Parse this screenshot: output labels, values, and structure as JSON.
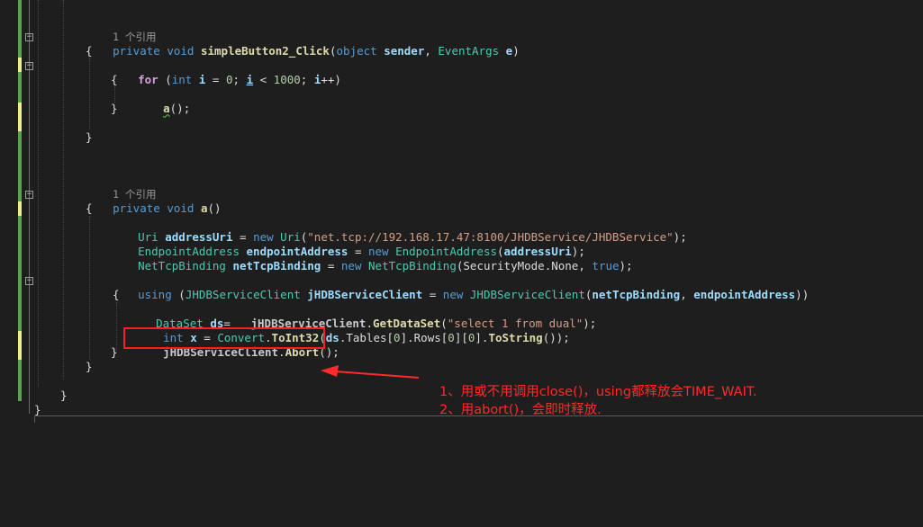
{
  "editor": {
    "refs_label_1": "1 个引用",
    "refs_label_2": "1 个引用",
    "method1": {
      "kw_private": "private",
      "kw_void": "void",
      "name": "simpleButton2_Click",
      "params": [
        {
          "type": "object",
          "name": "sender"
        },
        {
          "type": "EventArgs",
          "name": "e"
        }
      ],
      "loop": {
        "kw_for": "for",
        "kw_int": "int",
        "var": "i",
        "init": "0",
        "limit": "1000",
        "body_call": "a"
      }
    },
    "method2": {
      "kw_private": "private",
      "kw_void": "void",
      "name": "a",
      "line_uri": {
        "type": "Uri",
        "var": "addressUri",
        "kw_new": "new",
        "ctor": "Uri",
        "arg": "\"net.tcp://192.168.17.47:8100/JHDBService/JHDBService\""
      },
      "line_endpoint": {
        "type": "EndpointAddress",
        "var": "endpointAddress",
        "kw_new": "new",
        "ctor": "EndpointAddress",
        "arg": "addressUri"
      },
      "line_binding": {
        "type": "NetTcpBinding",
        "var": "netTcpBinding",
        "kw_new": "new",
        "ctor": "NetTcpBinding",
        "arg_type": "SecurityMode",
        "arg_member": "None",
        "arg_bool": "true"
      },
      "line_using": {
        "kw_using": "using",
        "type": "JHDBServiceClient",
        "var": "jHDBServiceClient",
        "kw_new": "new",
        "ctor": "JHDBServiceClient",
        "arg1": "netTcpBinding",
        "arg2": "endpointAddress"
      },
      "line_dataset": {
        "type": "DataSet",
        "var": "ds",
        "obj": "jHDBServiceClient",
        "method": "GetDataSet",
        "arg": "\"select 1 from dual\""
      },
      "line_int": {
        "kw_int": "int",
        "var": "x",
        "type": "Convert",
        "method": "ToInt32",
        "obj": "ds",
        "tables": "Tables",
        "rows": "Rows",
        "idx": "0",
        "tostring": "ToString"
      },
      "line_abort": {
        "obj": "jHDBServiceClient",
        "method": "Abort"
      }
    }
  },
  "annotation": {
    "line1": "1、用或不用调用close()，using都释放会TIME_WAIT.",
    "line2": "2、用abort()，会即时释放.",
    "color": "#ff2a2a"
  },
  "colors": {
    "background": "#1e1e1e",
    "keyword": "#569cd6",
    "control_keyword": "#d8a0df",
    "type": "#4ec9b0",
    "method": "#dcdcaa",
    "variable": "#9cdcfe",
    "string": "#d69d85",
    "number": "#b5cea8",
    "change_green": "#57a64a",
    "change_yellow": "#efef91"
  }
}
